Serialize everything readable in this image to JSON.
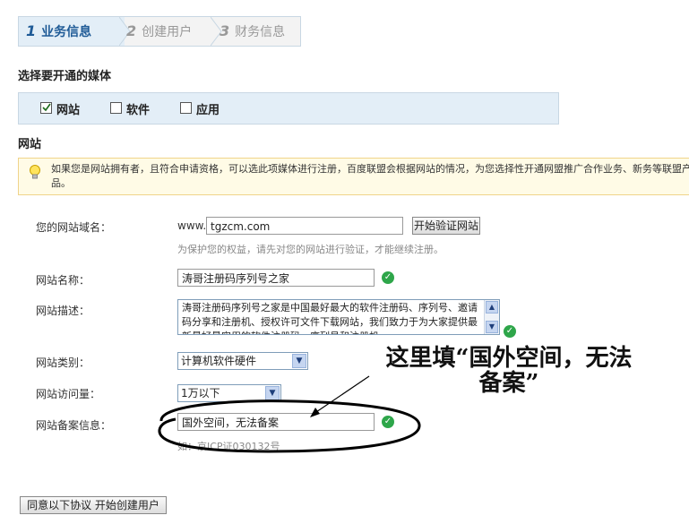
{
  "steps": [
    {
      "num": "1",
      "label": "业务信息"
    },
    {
      "num": "2",
      "label": "创建用户"
    },
    {
      "num": "3",
      "label": "财务信息"
    }
  ],
  "media": {
    "title": "选择要开通的媒体",
    "options": [
      {
        "label": "网站",
        "checked": true
      },
      {
        "label": "软件",
        "checked": false
      },
      {
        "label": "应用",
        "checked": false
      }
    ]
  },
  "site_section": {
    "title": "网站",
    "notice": "如果您是网站拥有者，且符合申请资格，可以选此项媒体进行注册，百度联盟会根据网站的情况，为您选择性开通网盟推广合作业务、新务等联盟产品。"
  },
  "form": {
    "domain_label": "您的网站域名：",
    "domain_prefix": "www.",
    "domain_value": "tgzcm.com",
    "verify_button": "开始验证网站",
    "domain_hint": "为保护您的权益，请先对您的网站进行验证，才能继续注册。",
    "name_label": "网站名称：",
    "name_value": "涛哥注册码序列号之家",
    "desc_label": "网站描述：",
    "desc_value": "涛哥注册码序列号之家是中国最好最大的软件注册码、序列号、邀请码分享和注册机、授权许可文件下载网站，我们致力于为大家提供最新最好最实用的软件注册码、序列号和注册机",
    "category_label": "网站类别：",
    "category_value": "计算机软件硬件",
    "traffic_label": "网站访问量：",
    "traffic_value": "1万以下",
    "icp_label": "网站备案信息：",
    "icp_value": "国外空间，无法备案",
    "icp_hint": "如：京ICP证030132号",
    "submit_button": "同意以下协议 开始创建用户"
  },
  "annotation": {
    "line1": "这里填“国外空间，无法",
    "line2": "备案”"
  },
  "colors": {
    "accent": "#1e5a96",
    "ok": "#2ea64a",
    "notice_bg": "#fffbe6"
  }
}
